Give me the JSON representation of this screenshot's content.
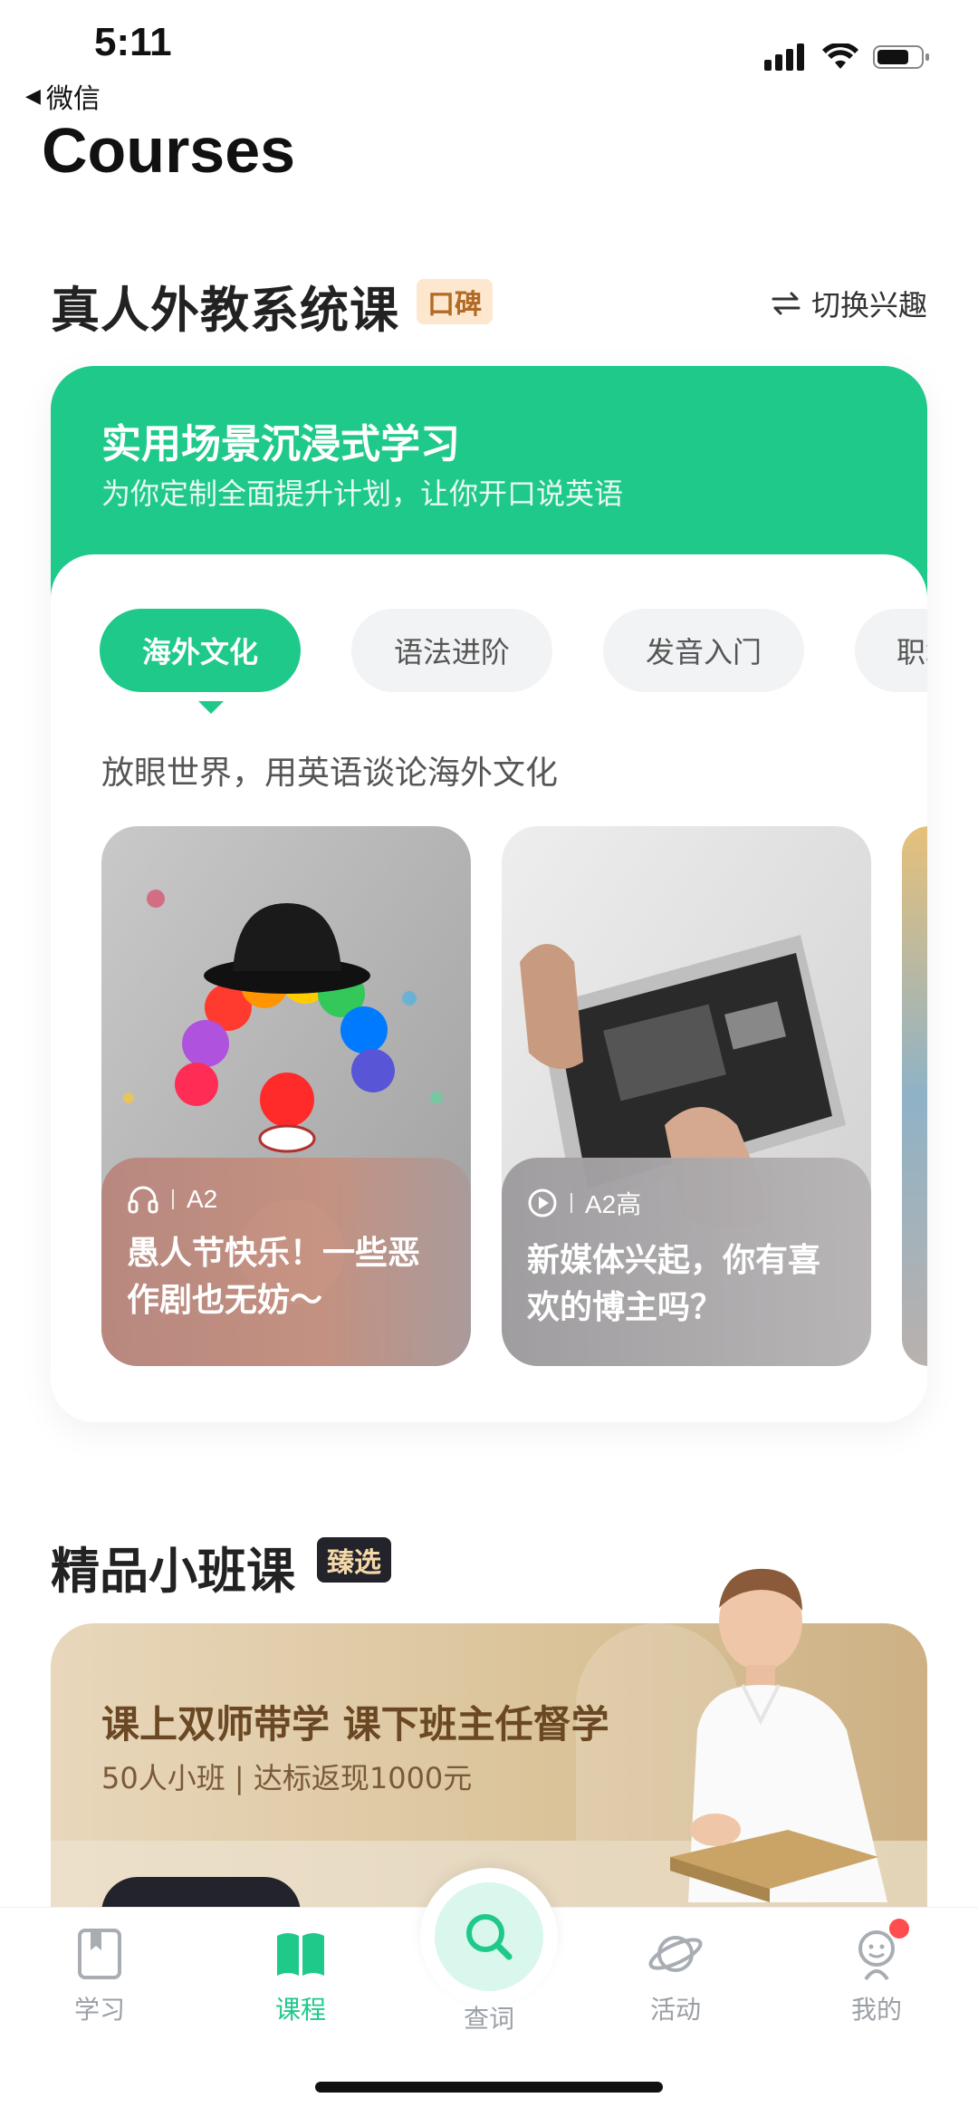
{
  "status": {
    "time": "5:11",
    "back_label": "微信"
  },
  "page": {
    "title": "Courses"
  },
  "section1": {
    "title": "真人外教系统课",
    "badge": "口碑",
    "switch_label": "切换兴趣",
    "card": {
      "title": "实用场景沉浸式学习",
      "subtitle": "为你定制全面提升计划，让你开口说英语",
      "tabs": [
        "海外文化",
        "语法进阶",
        "发音入门",
        "职场"
      ],
      "active_tab": 0,
      "description": "放眼世界，用英语谈论海外文化",
      "lessons": [
        {
          "icon": "headphones-icon",
          "level": "A2",
          "title": "愚人节快乐！一些恶作剧也无妨～"
        },
        {
          "icon": "play-icon",
          "level": "A2高",
          "title": "新媒体兴起，你有喜欢的博主吗？"
        }
      ]
    }
  },
  "section2": {
    "title": "精品小班课",
    "badge": "臻选",
    "promo_title": "课上双师带学 课下班主任督学",
    "promo_sub": "50人小班 | 达标返现1000元"
  },
  "tabbar": {
    "items": [
      {
        "label": "学习",
        "icon": "book-icon"
      },
      {
        "label": "课程",
        "icon": "open-book-icon"
      },
      {
        "label": "查词",
        "icon": "search-icon"
      },
      {
        "label": "活动",
        "icon": "planet-icon"
      },
      {
        "label": "我的",
        "icon": "profile-icon"
      }
    ],
    "active": 1
  },
  "colors": {
    "accent": "#1fc98a",
    "badge_bg": "#fde7cf",
    "dark": "#23232b"
  }
}
